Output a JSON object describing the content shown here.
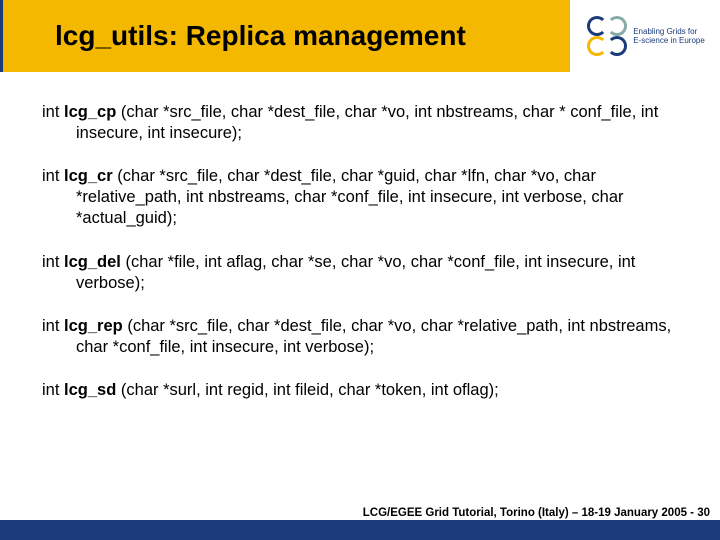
{
  "title": "lcg_utils: Replica management",
  "logo": {
    "line1": "Enabling Grids for",
    "line2": "E-science in Europe"
  },
  "functions": [
    {
      "ret": "int",
      "name": "lcg_cp",
      "args": " (char *src_file, char *dest_file, char *vo, int nbstreams, char * conf_file, int insecure, int insecure);"
    },
    {
      "ret": "int",
      "name": "lcg_cr",
      "args": " (char *src_file, char *dest_file, char *guid, char *lfn, char *vo, char *relative_path, int nbstreams, char *conf_file, int insecure, int verbose, char *actual_guid);"
    },
    {
      "ret": "int",
      "name": "lcg_del",
      "args": " (char *file, int aflag, char *se, char *vo, char *conf_file, int insecure, int verbose);"
    },
    {
      "ret": "int",
      "name": "lcg_rep",
      "args": " (char *src_file, char *dest_file, char *vo, char *relative_path, int nbstreams, char *conf_file, int insecure, int verbose);"
    },
    {
      "ret": "int",
      "name": "lcg_sd",
      "args": " (char *surl, int regid, int fileid, char *token, int oflag);"
    }
  ],
  "footer": "LCG/EGEE Grid Tutorial, Torino (Italy) – 18-19 January 2005 - 30"
}
